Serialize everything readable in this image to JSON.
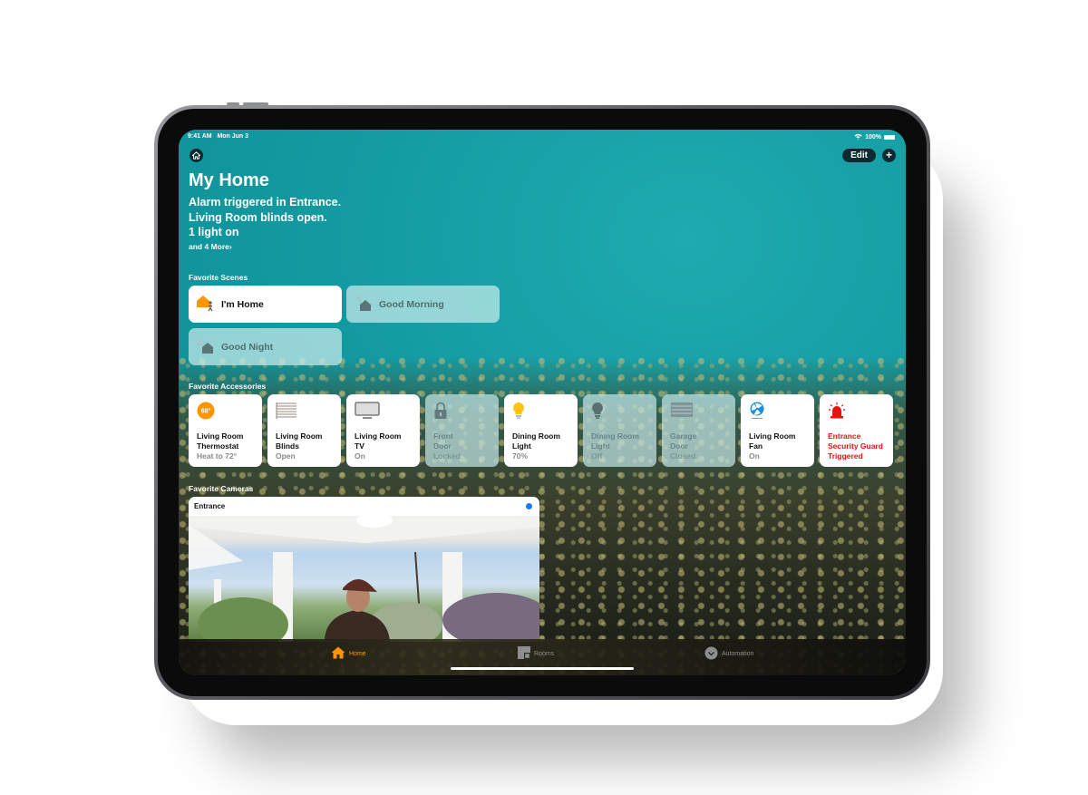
{
  "status_bar": {
    "time": "9:41 AM",
    "date": "Mon Jun 3",
    "battery": "100%"
  },
  "header": {
    "home_icon": "house-icon",
    "edit_label": "Edit",
    "add_label": "+",
    "title": "My Home",
    "summary": [
      "Alarm triggered in Entrance.",
      "Living Room blinds open.",
      "1 light on"
    ],
    "more_label": "and 4 More›"
  },
  "scenes": {
    "section_label": "Favorite Scenes",
    "items": [
      {
        "label": "I'm Home",
        "icon": "arrive-home-icon",
        "active": true
      },
      {
        "label": "Good Morning",
        "icon": "sun-house-icon",
        "active": false
      },
      {
        "label": "Good Night",
        "icon": "moon-house-icon",
        "active": false
      }
    ]
  },
  "accessories": {
    "section_label": "Favorite Accessories",
    "items": [
      {
        "line1": "Living Room",
        "line2": "Thermostat",
        "state": "Heat to 72°",
        "icon": "thermostat-icon",
        "badge": "68°",
        "active": true
      },
      {
        "line1": "Living Room",
        "line2": "Blinds",
        "state": "Open",
        "icon": "blinds-icon",
        "active": true
      },
      {
        "line1": "Living Room",
        "line2": "TV",
        "state": "On",
        "icon": "tv-icon",
        "active": true
      },
      {
        "line1": "Front",
        "line2": "Door",
        "state": "Locked",
        "icon": "lock-icon",
        "active": false
      },
      {
        "line1": "Dining Room",
        "line2": "Light",
        "state": "70%",
        "icon": "lightbulb-on-icon",
        "active": true
      },
      {
        "line1": "Dining Room",
        "line2": "Light",
        "state": "Off",
        "icon": "lightbulb-off-icon",
        "active": false
      },
      {
        "line1": "Garage",
        "line2": "Door",
        "state": "Closed",
        "icon": "garage-door-icon",
        "active": false
      },
      {
        "line1": "Living Room",
        "line2": "Fan",
        "state": "On",
        "icon": "fan-icon",
        "active": true
      },
      {
        "line1": "Entrance",
        "line2": "Security Guard",
        "state": "Triggered",
        "icon": "alarm-siren-icon",
        "active": true,
        "alert": true
      }
    ]
  },
  "cameras": {
    "section_label": "Favorite Cameras",
    "items": [
      {
        "name": "Entrance",
        "live": true
      }
    ]
  },
  "tabbar": {
    "tabs": [
      {
        "label": "Home",
        "icon": "house-icon",
        "selected": true
      },
      {
        "label": "Rooms",
        "icon": "rooms-icon",
        "selected": false
      },
      {
        "label": "Automation",
        "icon": "automation-icon",
        "selected": false
      }
    ]
  },
  "colors": {
    "accent": "#ff9500",
    "alert": "#e8120c",
    "live_dot": "#1d7cf2",
    "background_teal": "#139aa1"
  }
}
